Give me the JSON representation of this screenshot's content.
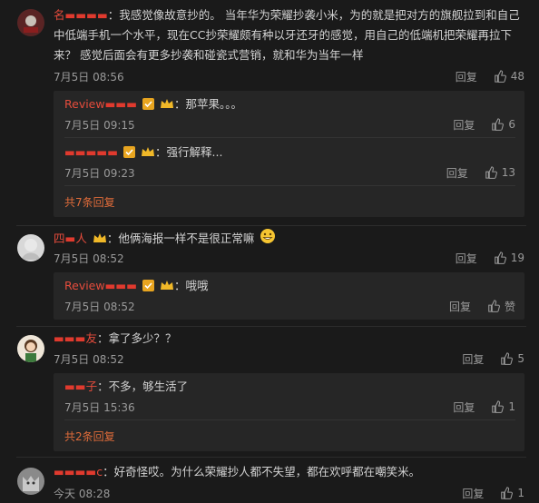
{
  "comments": [
    {
      "name": "名",
      "text": "：我感觉像故意抄的。 当年华为荣耀抄袭小米，为的就是把对方的旗舰拉到和自己中低端手机一个水平，现在CC抄荣耀颇有种以牙还牙的感觉，用自己的低端机把荣耀再拉下来？ 感觉后面会有更多抄袭和碰瓷式营销，就和华为当年一样",
      "time": "7月5日 08:56",
      "reply": "回复",
      "likes": "48",
      "replies": [
        {
          "name": "Review",
          "suffix": "",
          "text": "：那苹果。。。",
          "time": "7月5日 09:15",
          "reply": "回复",
          "likes": "6"
        },
        {
          "name": "",
          "suffix": "",
          "text": "：强行解释...",
          "time": "7月5日 09:23",
          "reply": "回复",
          "likes": "13"
        }
      ],
      "more": "共7条回复"
    },
    {
      "name": "四",
      "name_tail": "人",
      "text": "：他俩海报一样不是很正常嘛",
      "time": "7月5日 08:52",
      "reply": "回复",
      "likes": "19",
      "replies": [
        {
          "name": "Review",
          "suffix": "",
          "text": "：哦哦",
          "time": "7月5日 08:52",
          "reply": "回复",
          "likes": "赞"
        }
      ]
    },
    {
      "name": "",
      "name_tail": "友",
      "text": "：拿了多少？？",
      "time": "7月5日 08:52",
      "reply": "回复",
      "likes": "5",
      "replies": [
        {
          "name": "",
          "suffix": "子",
          "text": "：不多，够生活了",
          "time": "7月5日 15:36",
          "reply": "回复",
          "likes": "1"
        }
      ],
      "more": "共2条回复"
    },
    {
      "name": "",
      "name_tail": "c",
      "text": "：好奇怪哎。为什么荣耀抄人都不失望，都在欢呼都在嘲笑米。",
      "time": "今天 08:28",
      "reply": "回复",
      "likes": "1"
    }
  ],
  "colors": {
    "background": "#1a1a1a",
    "username": "#e64c3c",
    "more_link": "#e06c3a",
    "thread_bg": "#262626"
  },
  "icons": [
    "thumbs-up-icon",
    "verified-badge-icon",
    "member-crown-icon",
    "grin-emoji-icon"
  ]
}
